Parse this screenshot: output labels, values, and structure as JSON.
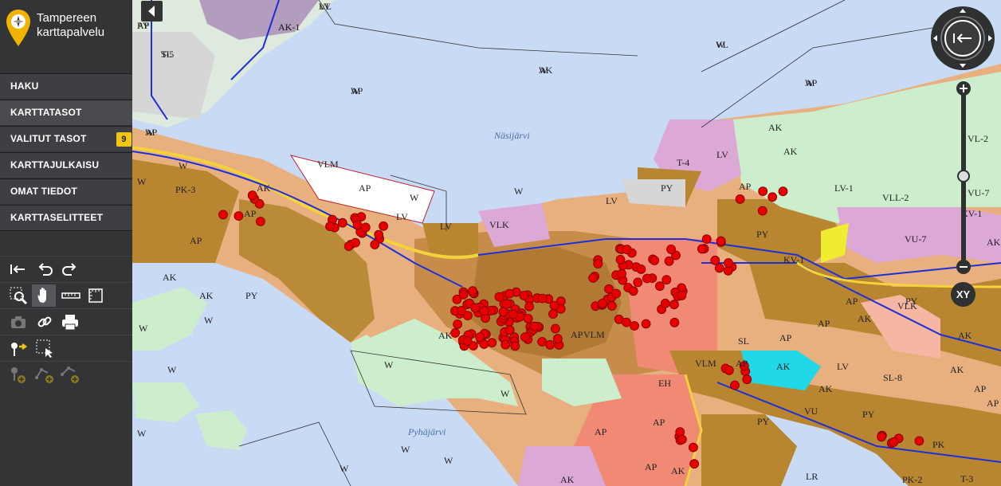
{
  "app": {
    "title_line1": "Tampereen",
    "title_line2": "karttapalvelu"
  },
  "menu": [
    {
      "label": "HAKU"
    },
    {
      "label": "KARTTATASOT"
    },
    {
      "label": "VALITUT TASOT",
      "badge": "9"
    },
    {
      "label": "KARTTAJULKAISU"
    },
    {
      "label": "OMAT TIEDOT"
    },
    {
      "label": "KARTTASELITTEET"
    }
  ],
  "tools": [
    [
      "history-reset-icon",
      "undo-icon",
      "redo-icon"
    ],
    [
      "zoom-box-icon",
      "pan-hand-icon",
      "measure-line-icon",
      "measure-area-icon"
    ],
    [
      "camera-icon",
      "link-icon",
      "print-icon"
    ],
    [
      "feature-info-icon",
      "select-area-icon"
    ],
    [
      "add-point-icon",
      "add-line-icon",
      "add-area-icon"
    ]
  ],
  "controls": {
    "xy_label": "XY"
  },
  "map": {
    "lakes": [
      "Näsijärvi",
      "Pyhäjärvi"
    ],
    "labels": [
      "LV",
      "PY",
      "AK-1",
      "T-5",
      "W",
      "W",
      "W",
      "W",
      "W",
      "W",
      "W",
      "W",
      "W",
      "W",
      "W",
      "W",
      "W",
      "W",
      "W",
      "W",
      "W",
      "W",
      "PK-3",
      "AP",
      "AK",
      "AP",
      "AK",
      "VLM",
      "AP",
      "LV",
      "LV",
      "VLK",
      "LV",
      "PY",
      "T-4",
      "LV",
      "AK",
      "AK",
      "AP",
      "LV-1",
      "VLL-2",
      "VL-2",
      "VU-7",
      "VU-7",
      "KV-1",
      "KV-1",
      "PY",
      "AP",
      "VLK",
      "AP",
      "AK",
      "AK",
      "PY",
      "AK",
      "AP",
      "VLM",
      "VLM",
      "SL",
      "AK",
      "AK",
      "PY",
      "VU",
      "EH",
      "AP",
      "AP",
      "AK",
      "AP",
      "AK",
      "PK",
      "PK-2",
      "T-3",
      "LR",
      "LV",
      "PY",
      "SL-8",
      "AP",
      "PY",
      "AP",
      "AK",
      "AP",
      "AK",
      "AP",
      "AK",
      "VL",
      "AP",
      "AK",
      "SL",
      "AP",
      "AK",
      "AP",
      "VL",
      "AP"
    ]
  }
}
